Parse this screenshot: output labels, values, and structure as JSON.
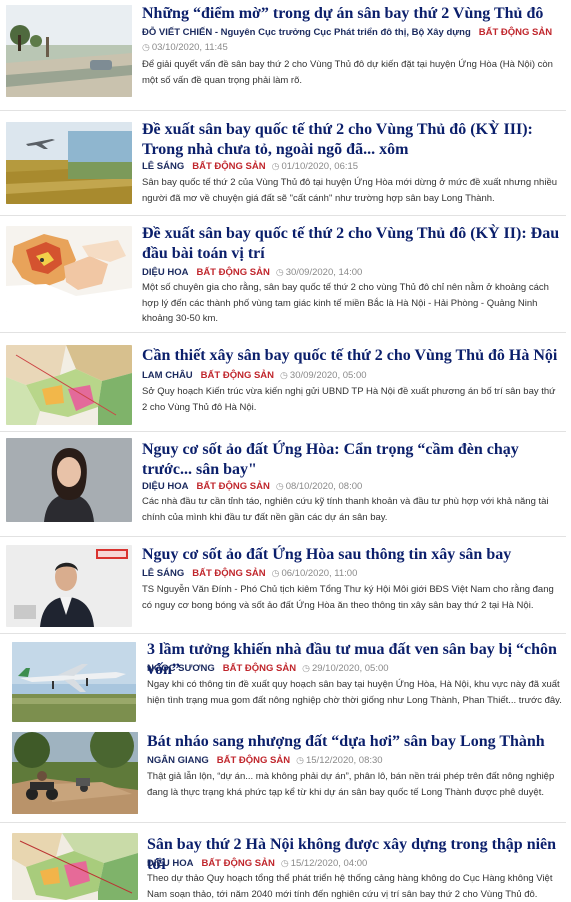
{
  "articles": [
    {
      "title": "Những “điểm mờ” trong dự án sân bay thứ 2 Vùng Thủ đô",
      "author": "ĐỖ VIẾT CHIẾN - Nguyên Cục trưởng Cục Phát triển đô thị, Bộ Xây dựng",
      "category": "BẤT ĐỘNG SẢN",
      "date": "03/10/2020, 11:45",
      "summary": "Để giải quyết vấn đề sân bay thứ 2 cho Vùng Thủ đô dự kiến đặt tại huyện Ứng Hòa (Hà Nội) còn một số vấn đề quan trọng phải làm rõ.",
      "thumb_icon": "rural-road-photo-icon"
    },
    {
      "title": "Đề xuất sân bay quốc tế thứ 2 cho Vùng Thủ đô (KỲ III): Trong nhà chưa tỏ, ngoài ngõ đã... xôm",
      "author": "LÊ SÁNG",
      "category": "BẤT ĐỘNG SẢN",
      "date": "01/10/2020, 06:15",
      "summary": "Sân bay quốc tế thứ 2 của Vùng Thủ đô tại huyện Ứng Hòa mới dừng ở mức đề xuất nhưng nhiều người đã mơ về chuyện giá đất sẽ \"cất cánh\" như trường hợp sân bay Long Thành.",
      "thumb_icon": "airplane-field-photo-icon"
    },
    {
      "title": "Đề xuất sân bay quốc tế thứ 2 cho Vùng Thủ đô (KỲ II): Đau đầu bài toán vị trí",
      "author": "DIỆU HOA",
      "category": "BẤT ĐỘNG SẢN",
      "date": "30/09/2020, 14:00",
      "summary": "Một số chuyên gia cho rằng, sân bay quốc tế thứ 2 cho vùng Thủ đô chỉ nên nằm ở khoảng cách hợp lý đến các thành phố vùng tam giác kinh tế miền Bắc là Hà Nội - Hải Phòng - Quảng Ninh khoảng 30-50 km.",
      "thumb_icon": "region-map-icon"
    },
    {
      "title": "Cần thiết xây sân bay quốc tế thứ 2 cho Vùng Thủ đô Hà Nội",
      "author": "LAM CHÂU",
      "category": "BẤT ĐỘNG SẢN",
      "date": "30/09/2020, 05:00",
      "summary": "Sở Quy hoạch Kiến trúc vừa kiến nghị gửi UBND TP Hà Nội đề xuất phương án bố trí sân bay thứ 2 cho Vùng Thủ đô Hà Nội.",
      "thumb_icon": "planning-map-icon"
    },
    {
      "title": "Nguy cơ sốt ảo đất Ứng Hòa: Cẩn trọng “cầm đèn chạy trước... sân bay\"",
      "author": "DIỆU HOA",
      "category": "BẤT ĐỘNG SẢN",
      "date": "08/10/2020, 08:00",
      "summary": "Các nhà đầu tư cần tỉnh táo, nghiên cứu kỹ tính thanh khoản và đầu tư phù hợp với khả năng tài chính của mình khi đầu tư đất nền gần các dự án sân bay.",
      "thumb_icon": "woman-portrait-icon"
    },
    {
      "title": "Nguy cơ sốt ảo đất Ứng Hòa sau thông tin xây sân bay",
      "author": "LÊ SÁNG",
      "category": "BẤT ĐỘNG SẢN",
      "date": "06/10/2020, 11:00",
      "summary": "TS Nguyễn Văn Đính - Phó Chủ tịch kiêm Tổng Thư ký Hội Môi giới BĐS Việt Nam cho rằng đang có nguy cơ bong bóng và sốt ảo đất Ứng Hòa ăn theo thông tin xây sân bay thứ 2 tại Hà Nội.",
      "thumb_icon": "man-portrait-icon"
    },
    {
      "title": "3 lầm tưởng khiến nhà đầu tư mua đất ven sân bay bị “chôn vốn”",
      "author": "NGỌC SƯƠNG",
      "category": "BẤT ĐỘNG SẢN",
      "date": "29/10/2020, 05:00",
      "summary": "Ngay khi có thông tin đề xuất quy hoạch sân bay tại huyện Ứng Hòa, Hà Nội, khu vực này đã xuất hiện tình trạng mua gom đất nông nghiệp chờ thời giống như Long Thành, Phan Thiết... trước đây.",
      "thumb_icon": "airplane-landing-photo-icon"
    },
    {
      "title": "Bát nháo sang nhượng đất “dựa hơi” sân bay Long Thành",
      "author": "NGÂN GIANG",
      "category": "BẤT ĐỘNG SẢN",
      "date": "15/12/2020, 08:30",
      "summary": "Thật giả lẫn lộn, “dự án... mà không phải dự án”, phân lô, bán nền trái phép trên đất nông nghiệp đang là thực trạng khá phức tạp kể từ khi dự án sân bay quốc tế Long Thành được phê duyệt.",
      "thumb_icon": "motorbike-road-photo-icon"
    },
    {
      "title": "Sân bay thứ 2 Hà Nội không được xây dựng trong thập niên tới",
      "author": "DIỆU HOA",
      "category": "BẤT ĐỘNG SẢN",
      "date": "15/12/2020, 04:00",
      "summary": "Theo dự thảo Quy hoạch tổng thể phát triển hệ thống cảng hàng không do Cục Hàng không Việt Nam soạn thảo, tới năm 2040 mới tính đến nghiên cứu vị trí sân bay thứ 2 cho Vùng Thủ đô.",
      "thumb_icon": "hanoi-map-icon"
    }
  ]
}
